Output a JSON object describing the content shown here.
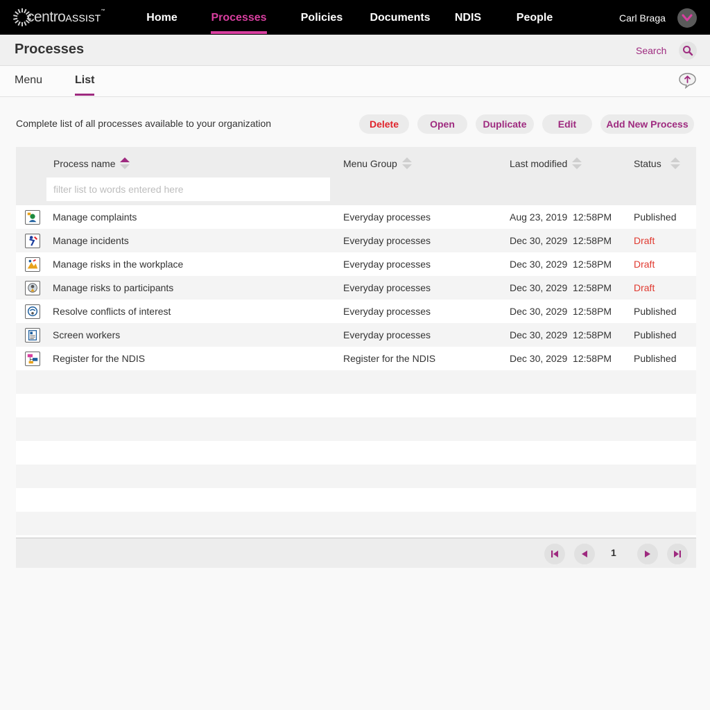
{
  "brand": {
    "name_part1": "centro",
    "name_part2": "ASSIST",
    "trademark": "™"
  },
  "nav": {
    "items": [
      {
        "label": "Home"
      },
      {
        "label": "Processes"
      },
      {
        "label": "Policies"
      },
      {
        "label": "Documents"
      },
      {
        "label": "NDIS"
      },
      {
        "label": "People"
      }
    ],
    "active": "Processes",
    "user": "Carl Braga"
  },
  "header": {
    "title": "Processes",
    "search_label": "Search"
  },
  "tabs": [
    {
      "label": "Menu"
    },
    {
      "label": "List"
    }
  ],
  "active_tab": "List",
  "toolbar": {
    "description": "Complete list of all processes available to your organization",
    "delete": "Delete",
    "open": "Open",
    "duplicate": "Duplicate",
    "edit": "Edit",
    "add": "Add New Process"
  },
  "table": {
    "columns": {
      "name": "Process name",
      "group": "Menu Group",
      "modified": "Last modified",
      "status": "Status"
    },
    "filter_placeholder": "filter list to words entered here",
    "rows": [
      {
        "name": "Manage complaints",
        "group": "Everyday processes",
        "modified": "Aug 23, 2019  12:58PM",
        "status": "Published",
        "icon": "complaints-icon"
      },
      {
        "name": "Manage incidents",
        "group": "Everyday processes",
        "modified": "Dec 30, 2029  12:58PM",
        "status": "Draft",
        "icon": "incident-icon"
      },
      {
        "name": "Manage risks in the workplace",
        "group": "Everyday processes",
        "modified": "Dec 30, 2029  12:58PM",
        "status": "Draft",
        "icon": "workplace-risk-icon"
      },
      {
        "name": "Manage risks to participants",
        "group": "Everyday processes",
        "modified": "Dec 30, 2029  12:58PM",
        "status": "Draft",
        "icon": "participant-risk-icon"
      },
      {
        "name": "Resolve conflicts of interest",
        "group": "Everyday processes",
        "modified": "Dec 30, 2029  12:58PM",
        "status": "Published",
        "icon": "conflict-icon"
      },
      {
        "name": "Screen workers",
        "group": "Everyday processes",
        "modified": "Dec 30, 2029  12:58PM",
        "status": "Published",
        "icon": "screening-icon"
      },
      {
        "name": "Register for the NDIS",
        "group": "Register for the NDIS",
        "modified": "Dec 30, 2029  12:58PM",
        "status": "Published",
        "icon": "register-icon"
      }
    ],
    "empty_rows": 7
  },
  "pagination": {
    "current_page": "1"
  },
  "colors": {
    "accent": "#9e2a7f",
    "nav_active": "#d93fa0",
    "draft": "#e0392f",
    "danger": "#e0232b"
  }
}
